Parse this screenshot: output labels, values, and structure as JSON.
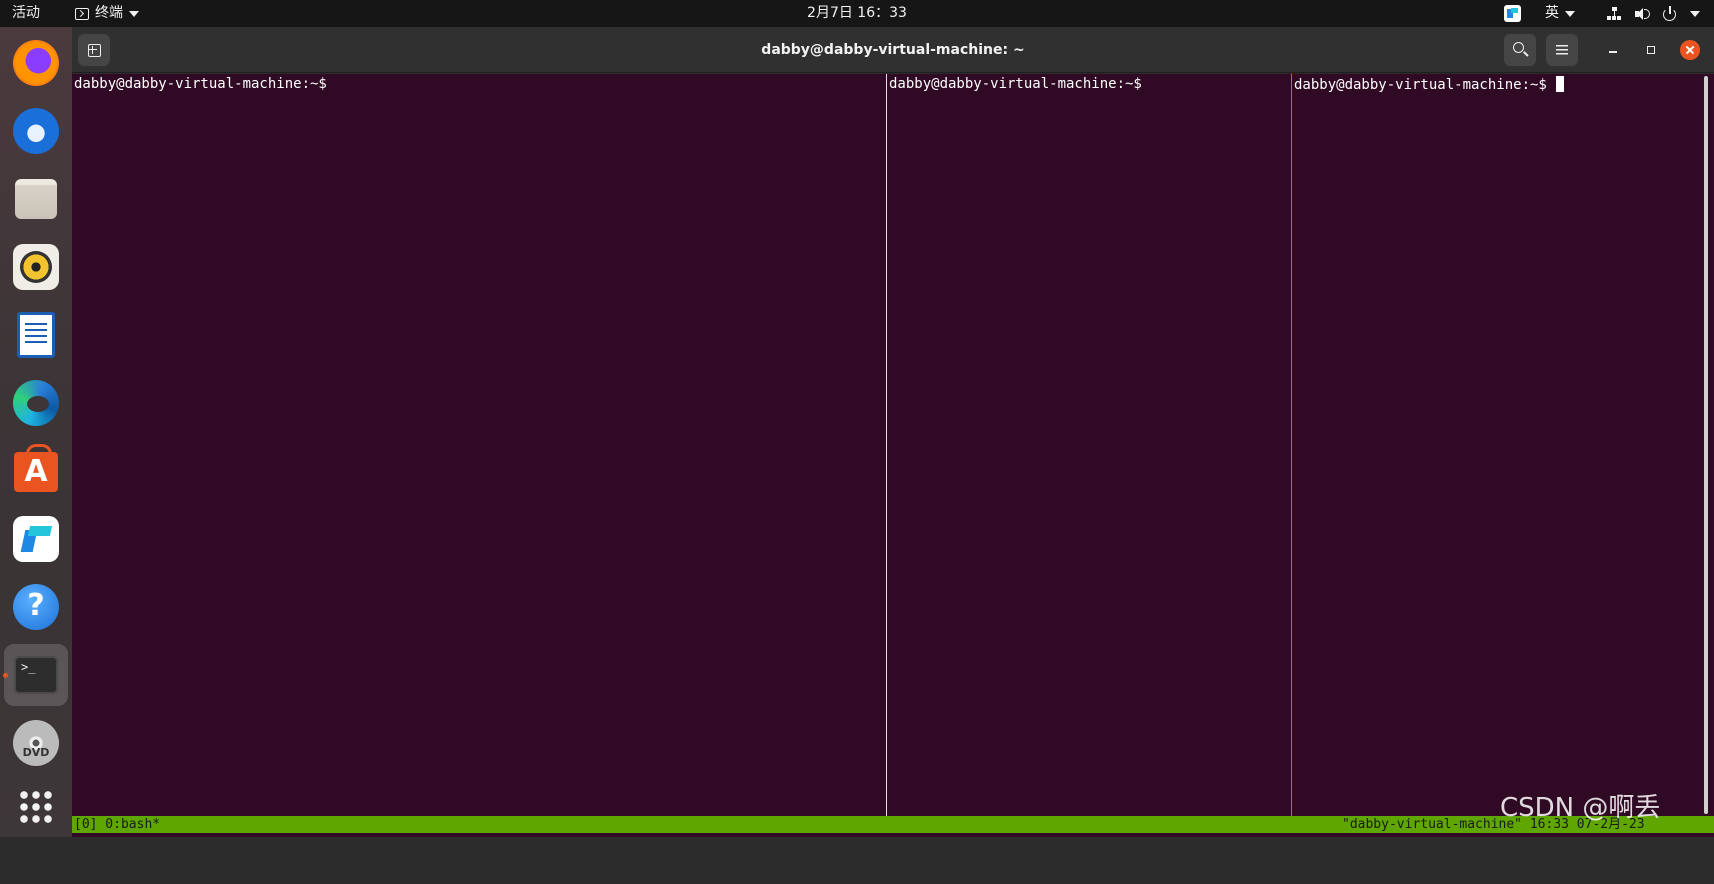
{
  "topbar": {
    "activities": "活动",
    "app_menu": "终端",
    "clock": "2月7日  16：33",
    "ime": "英"
  },
  "dock": {
    "items": [
      {
        "icon": "firefox-icon"
      },
      {
        "icon": "thunderbird-icon"
      },
      {
        "icon": "files-icon"
      },
      {
        "icon": "rhythmbox-icon"
      },
      {
        "icon": "writer-icon"
      },
      {
        "icon": "edge-icon"
      },
      {
        "icon": "software-icon"
      },
      {
        "icon": "todesk-icon"
      },
      {
        "icon": "help-icon"
      },
      {
        "icon": "terminal-icon",
        "active": true
      },
      {
        "icon": "dvd-icon"
      },
      {
        "icon": "apps-grid-icon"
      }
    ]
  },
  "window": {
    "title": "dabby@dabby-virtual-machine: ~"
  },
  "terminal": {
    "panes": [
      {
        "prompt": "dabby@dabby-virtual-machine:~$ "
      },
      {
        "prompt": "dabby@dabby-virtual-machine:~$ "
      },
      {
        "prompt": "dabby@dabby-virtual-machine:~$ "
      }
    ],
    "status_left": "[0] 0:bash*",
    "status_right": "\"dabby-virtual-machine\" 16:33 07-2月-23"
  },
  "watermark": "CSDN @啊丢",
  "colors": {
    "terminal_bg": "#300a24",
    "status_bar": "#5fa700",
    "close_button": "#e95420"
  }
}
